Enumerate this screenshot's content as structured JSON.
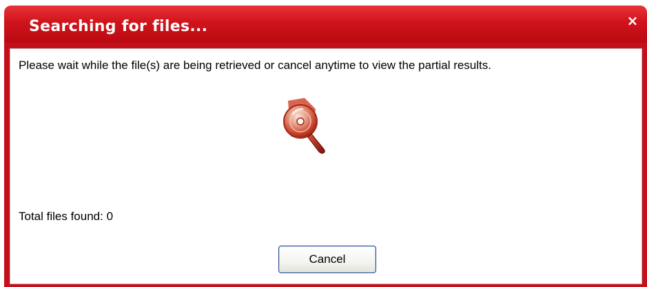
{
  "dialog": {
    "title": "Searching for files...",
    "close_glyph": "×",
    "message": "Please wait while the file(s) are being retrieved or cancel anytime to view the partial results.",
    "status": {
      "label": "Total files found:",
      "count": "0"
    },
    "cancel_label": "Cancel",
    "icon": "disc-search-icon"
  },
  "colors": {
    "titlebar": "#d0131b",
    "frame": "#c4101a",
    "icon_red": "#c83a28",
    "button_border": "#2a4b8d"
  }
}
